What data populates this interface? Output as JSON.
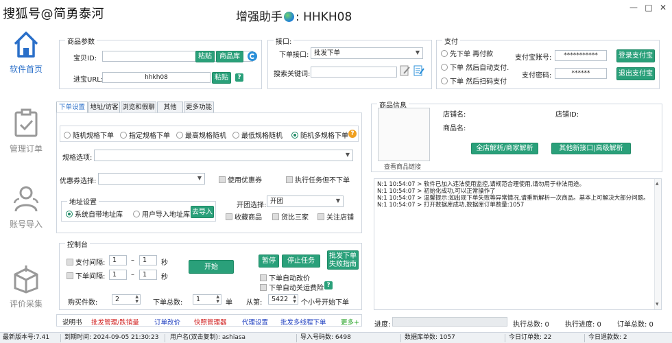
{
  "window": {
    "watermark": "搜狐号@简勇泰河",
    "title_prefix": "增强助手",
    "title_sep": ":",
    "title_suffix": "HHKH08",
    "controls": [
      "—",
      "□",
      "✕"
    ]
  },
  "sidebar": {
    "items": [
      {
        "label": "软件首页",
        "icon": "home-icon"
      },
      {
        "label": "管理订单",
        "icon": "clipboard-check-icon"
      },
      {
        "label": "账号导入",
        "icon": "users-icon"
      },
      {
        "label": "评价采集",
        "icon": "box-icon"
      }
    ]
  },
  "product_params": {
    "title": "商品参数",
    "item_id_label": "宝贝ID:",
    "item_id_value": "",
    "paste_label": "粘贴",
    "library_label": "商品库",
    "url_label": "进宝URL:",
    "url_value": "hhkh08",
    "paste2_label": "粘贴",
    "help": "?"
  },
  "interface": {
    "title": "接口:",
    "order_api_label": "下单接口:",
    "order_api_value": "批发下单",
    "keyword_label": "搜索关键词:",
    "keyword_value": ""
  },
  "payment": {
    "title": "支付",
    "options": [
      "先下单 再付款",
      "下单 然后自动支付.",
      "下单 然后扫码支付"
    ],
    "account_label": "支付宝账号:",
    "account_value": "***********",
    "password_label": "支付密码:",
    "password_value": "******",
    "login_btn": "登录支付宝",
    "logout_btn": "退出支付宝"
  },
  "tabs": [
    "下单设置",
    "地址/访客",
    "浏览和假聊",
    "其他",
    "更多功能"
  ],
  "order_settings": {
    "mode_options": [
      "随机规格下单",
      "指定规格下单",
      "最高规格随机",
      "最低规格随机",
      "随机多规格下单"
    ],
    "mode_selected_index": 4,
    "spec_label": "规格选项:",
    "spec_value": "",
    "coupon_label": "优惠券选择:",
    "coupon_value": "",
    "use_coupon": "使用优惠券",
    "exec_no_order": "执行任务但不下单",
    "address_title": "地址设置",
    "address_options": [
      "系统自带地址库",
      "用户导入地址库"
    ],
    "import_btn": "去导入",
    "group_label": "开团选择:",
    "group_value": "开团",
    "checks": [
      "收藏商品",
      "货比三家",
      "关注店铺"
    ]
  },
  "console": {
    "title": "控制台",
    "pay_interval_label": "支付间隔:",
    "pay_interval_from": "1",
    "pay_interval_to": "1",
    "order_interval_label": "下单间隔:",
    "order_interval_from": "1",
    "order_interval_to": "1",
    "dash": "–",
    "sec": "秒",
    "start_btn": "开始",
    "pause_btn": "暂停",
    "stop_btn": "停止任务",
    "guide_btn_line1": "批发下单",
    "guide_btn_line2": "失败指南",
    "auto_price": "下单自动改价",
    "auto_insure": "下单自动关运费险",
    "qty_label": "购买件数:",
    "qty_value": "2",
    "total_label": "下单总数:",
    "total_value": "1",
    "unit": "单",
    "from_label": "从第:",
    "from_value": "5422",
    "from_suffix": "个小号开始下单"
  },
  "bottom_links": [
    {
      "label": "说明书",
      "color": "#222222"
    },
    {
      "label": "批发管理/跌销量",
      "color": "#d02020"
    },
    {
      "label": "订单改价",
      "color": "#2040c0"
    },
    {
      "label": "快照管理器",
      "color": "#d02020"
    },
    {
      "label": "代理设置",
      "color": "#2040c0"
    },
    {
      "label": "批发多线程下单",
      "color": "#2040c0"
    },
    {
      "label": "更多+",
      "color": "#20a020"
    }
  ],
  "product_info": {
    "title": "商品信息",
    "shop_name_label": "店铺名:",
    "shop_id_label": "店铺ID:",
    "item_name_label": "商品名:",
    "parse_btn": "全店解析/商家解析",
    "parse_other_btn": "其他新接口|高级解析",
    "view_link": "查看商品链接"
  },
  "log_lines": [
    "N:1 10:54:07 > 软件已加入违法使用监控,请规范合理使用,请勿用于非法用途。",
    "N:1 10:54:07 > 初始化成功,可以正常操作了",
    "N:1 10:54:07 > 温馨提示:如出现下单失败等异常情况,请重新解析一次商品。基本上可解决大部分问题。",
    "N:1 10:54:07 > 打开数据库成功,数据库订单数量:1057"
  ],
  "progress": {
    "label": "进度:",
    "value": 0,
    "exec_total": "执行总数: 0",
    "exec_progress": "执行进度: 0",
    "order_total": "订单总数: 0"
  },
  "status": {
    "version": "最新版本号:7.41",
    "expire": "到期时间: 2024-09-05 21:30:23",
    "user": "用户名(双击复制): ashiasa",
    "imported": "导入号码数: 6498",
    "db_orders": "数据库单数: 1057",
    "today_orders": "今日订单数: 22",
    "today_refunds": "今日退款数: 2"
  },
  "colors": {
    "accent_green": "#2aa07a",
    "active_blue": "#2a6fc9",
    "help_blue": "#2a8fd8",
    "help_orange": "#f0a020"
  }
}
